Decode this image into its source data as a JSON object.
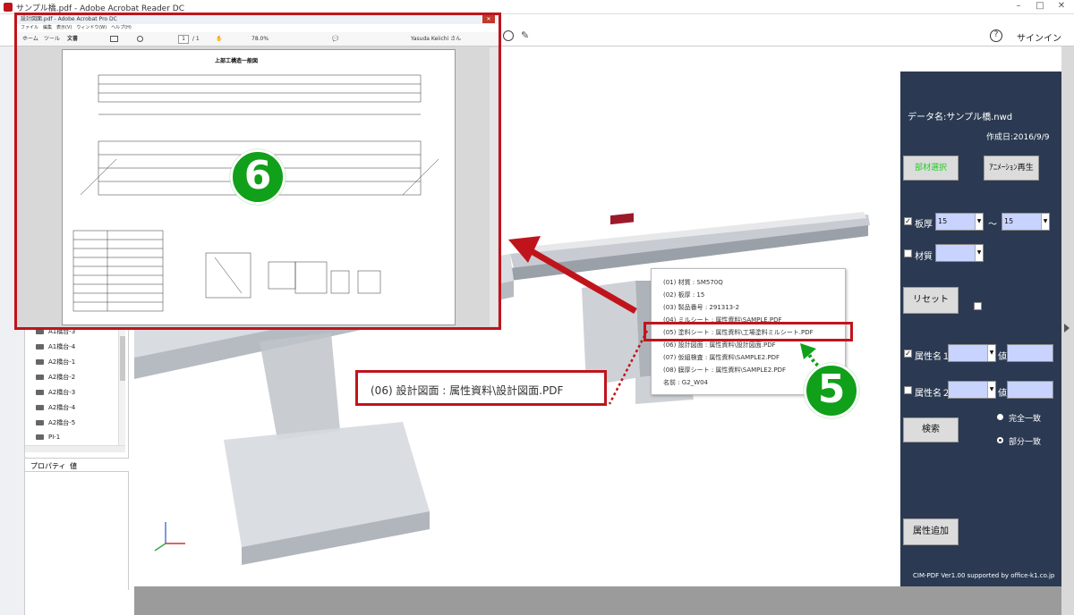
{
  "window": {
    "title": "サンプル橋.pdf - Adobe Acrobat Reader DC"
  },
  "toolbar": {
    "signin": "サインイン",
    "help": "?"
  },
  "tree": {
    "items": [
      "A1橋台-3",
      "A1橋台-4",
      "A2橋台-1",
      "A2橋台-2",
      "A2橋台-3",
      "A2橋台-4",
      "A2橋台-5",
      "PI-1"
    ]
  },
  "props": {
    "tab1": "プロパティ",
    "tab2": "値"
  },
  "panel": {
    "data_name": "データ名:サンプル橋.nwd",
    "created": "作成日:2016/9/9",
    "btn_member": "部材選択",
    "btn_anim": "ｱﾆﾒｰｼｮﾝ再生",
    "thickness_label": "板厚",
    "thickness_from": "15",
    "tilde": "～",
    "thickness_to": "15",
    "material_label": "材質",
    "btn_reset": "リセット",
    "attr1_label": "属性名１",
    "attr2_label": "属性名２",
    "value_label": "値",
    "btn_search": "検索",
    "radio_exact": "完全一致",
    "radio_partial": "部分一致",
    "btn_add_attr": "属性追加",
    "footer": "CIM-PDF Ver1.00 supported by office-k1.co.jp"
  },
  "inset": {
    "title": "設計図面.pdf - Adobe Acrobat Pro DC",
    "menu": "ファイル　編集　表示(V)　ウィンドウ(W)　ヘルプ(H)",
    "tabs": [
      "ホーム",
      "ツール",
      "文書"
    ],
    "page_num": "1",
    "page_total": "/ 1",
    "zoom": "78.0%",
    "user": "Yasuda Keiichi さん",
    "drawing_title": "上部工構造一般図"
  },
  "popup": {
    "lines": [
      "(01) 材質 : SM570Q",
      "(02) 板厚 : 15",
      "(03) 製品番号 : 291313-2",
      "(04) ミルシート : 属性資料\\SAMPLE.PDF",
      "(05) 塗料シート : 属性資料\\工場塗料ミルシート.PDF",
      "(06) 設計図面 : 属性資料\\設計図面.PDF",
      "(07) 仮組検査 : 属性資料\\SAMPLE2.PDF",
      "(08) 膜厚シート : 属性資料\\SAMPLE2.PDF",
      "名前 : G2_W04"
    ]
  },
  "callout": {
    "text": "(06) 設計図面 : 属性資料\\設計図面.PDF"
  },
  "badges": {
    "b5": "5",
    "b6": "6"
  },
  "colors": {
    "panel": "#2b3a52",
    "highlight": "#c0141c",
    "badge": "#10a01a",
    "field": "#c9d3ff",
    "member_btn_text": "#22cc22"
  }
}
